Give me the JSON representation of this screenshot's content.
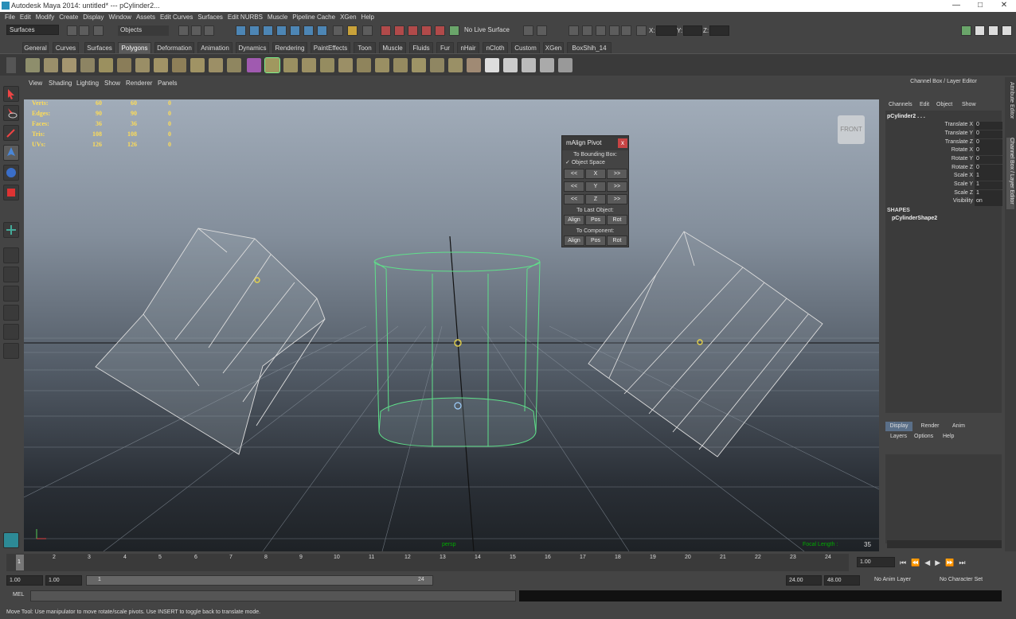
{
  "window": {
    "title": "Autodesk Maya 2014: untitled*  ---  pCylinder2..."
  },
  "menu": [
    "File",
    "Edit",
    "Modify",
    "Create",
    "Display",
    "Window",
    "Assets",
    "Edit Curves",
    "Surfaces",
    "Edit NURBS",
    "Muscle",
    "Pipeline Cache",
    "XGen",
    "Help"
  ],
  "status": {
    "mode": "Surfaces",
    "selection_mask": "Objects",
    "live": "No Live Surface",
    "x_label": "X:",
    "y_label": "Y:",
    "z_label": "Z:"
  },
  "shelf_tabs": [
    "General",
    "Curves",
    "Surfaces",
    "Polygons",
    "Deformation",
    "Animation",
    "Dynamics",
    "Rendering",
    "PaintEffects",
    "Toon",
    "Muscle",
    "Fluids",
    "Fur",
    "nHair",
    "nCloth",
    "Custom",
    "XGen",
    "BoxShih_14"
  ],
  "shelf_active": "Polygons",
  "viewport_menu": [
    "View",
    "Shading",
    "Lighting",
    "Show",
    "Renderer",
    "Panels"
  ],
  "hud": [
    {
      "label": "Verts:",
      "a": "60",
      "b": "60",
      "c": "0"
    },
    {
      "label": "Edges:",
      "a": "90",
      "b": "90",
      "c": "0"
    },
    {
      "label": "Faces:",
      "a": "36",
      "b": "36",
      "c": "0"
    },
    {
      "label": "Tris:",
      "a": "108",
      "b": "108",
      "c": "0"
    },
    {
      "label": "UVs:",
      "a": "126",
      "b": "126",
      "c": "0"
    }
  ],
  "viewcube": "FRONT",
  "viewport_footer": {
    "camera": "persp",
    "focal_label": "Focal Length :",
    "focal_value": "35"
  },
  "pivot_window": {
    "title": "mAlign Pivot",
    "close": "x",
    "bbox_label": "To Bounding Box:",
    "object_space": "Object Space",
    "rows": [
      {
        "left": "<<",
        "axis": "X",
        "right": ">>"
      },
      {
        "left": "<<",
        "axis": "Y",
        "right": ">>"
      },
      {
        "left": "<<",
        "axis": "Z",
        "right": ">>"
      }
    ],
    "last_label": "To Last Object:",
    "comp_label": "To Component:",
    "buttons": [
      "Align",
      "Pos",
      "Rot"
    ]
  },
  "channel_box": {
    "title": "Channel Box / Layer Editor",
    "menu": [
      "Channels",
      "Edit",
      "Object",
      "Show"
    ],
    "object": "pCylinder2 . . .",
    "channels": [
      {
        "name": "Translate X",
        "value": "0"
      },
      {
        "name": "Translate Y",
        "value": "0"
      },
      {
        "name": "Translate Z",
        "value": "0"
      },
      {
        "name": "Rotate X",
        "value": "0"
      },
      {
        "name": "Rotate Y",
        "value": "0"
      },
      {
        "name": "Rotate Z",
        "value": "0"
      },
      {
        "name": "Scale X",
        "value": "1"
      },
      {
        "name": "Scale Y",
        "value": "1"
      },
      {
        "name": "Scale Z",
        "value": "1"
      },
      {
        "name": "Visibility",
        "value": "on"
      }
    ],
    "shapes_label": "SHAPES",
    "shape": "pCylinderShape2",
    "layer_tabs": [
      "Display",
      "Render",
      "Anim"
    ],
    "layer_menu": [
      "Layers",
      "Options",
      "Help"
    ]
  },
  "side_tabs": [
    "Attribute Editor",
    "Channel Box / Layer Editor"
  ],
  "timeline": {
    "ticks": [
      "1",
      "2",
      "3",
      "4",
      "5",
      "6",
      "7",
      "8",
      "9",
      "10",
      "11",
      "12",
      "13",
      "14",
      "15",
      "16",
      "17",
      "18",
      "19",
      "20",
      "21",
      "22",
      "23",
      "24"
    ],
    "current": "1.00"
  },
  "range": {
    "start": "1.00",
    "inner_start": "1.00",
    "slider_start": "1",
    "slider_end": "24",
    "end": "24.00",
    "outer_end": "48.00",
    "anim_layer": "No Anim Layer",
    "char_set": "No Character Set"
  },
  "mel": {
    "label": "MEL"
  },
  "help_line": "Move Tool: Use manipulator to move rotate/scale pivots. Use INSERT to toggle back to translate mode."
}
